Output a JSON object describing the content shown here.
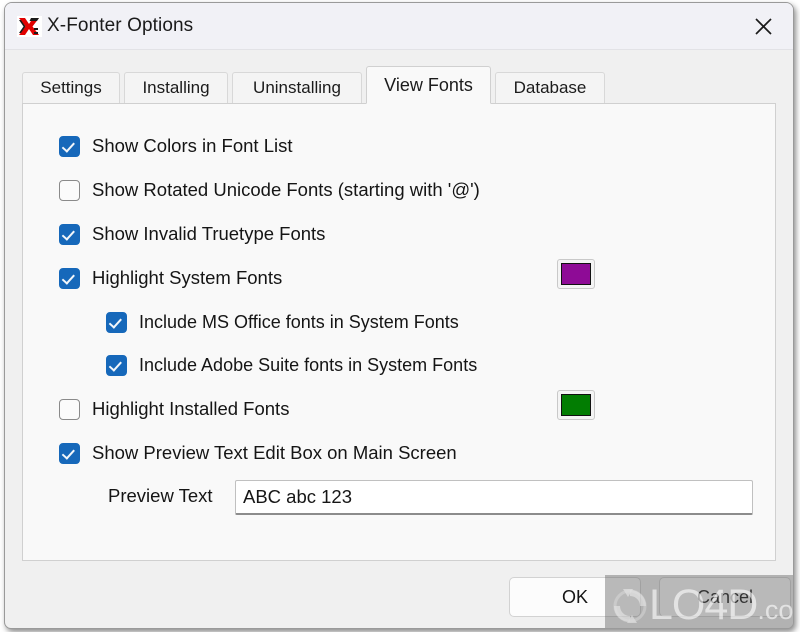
{
  "window": {
    "title": "X-Fonter Options",
    "app_icon": "x-fonter-logo-icon",
    "close_icon": "close-icon"
  },
  "tabs": [
    {
      "label": "Settings",
      "active": false
    },
    {
      "label": "Installing",
      "active": false
    },
    {
      "label": "Uninstalling",
      "active": false
    },
    {
      "label": "View Fonts",
      "active": true
    },
    {
      "label": "Database",
      "active": false
    }
  ],
  "options": [
    {
      "label": "Show Colors in Font List",
      "checked": true,
      "indent": false
    },
    {
      "label": "Show Rotated Unicode Fonts (starting with '@')",
      "checked": false,
      "indent": false
    },
    {
      "label": "Show Invalid Truetype Fonts",
      "checked": true,
      "indent": false
    },
    {
      "label": "Highlight System Fonts",
      "checked": true,
      "indent": false
    },
    {
      "label": "Include MS Office fonts in System Fonts",
      "checked": true,
      "indent": true
    },
    {
      "label": "Include Adobe Suite fonts in System Fonts",
      "checked": true,
      "indent": true
    },
    {
      "label": "Highlight Installed Fonts",
      "checked": false,
      "indent": false
    },
    {
      "label": "Show Preview Text Edit Box on Main Screen",
      "checked": true,
      "indent": false
    }
  ],
  "swatches": {
    "system_fonts_color": "#8e0b96",
    "installed_fonts_color": "#027d02"
  },
  "preview": {
    "label": "Preview Text",
    "value": "ABC abc 123",
    "placeholder": ""
  },
  "buttons": {
    "ok": "OK",
    "cancel": "Cancel"
  },
  "watermark": {
    "name": "LO4D",
    "domain": ".com"
  },
  "colors": {
    "checkbox_accent": "#1668ba",
    "titlebar_bg": "#f1f1f6",
    "dialog_bg": "#f0f0f0",
    "panel_bg": "#f9f9f9"
  }
}
